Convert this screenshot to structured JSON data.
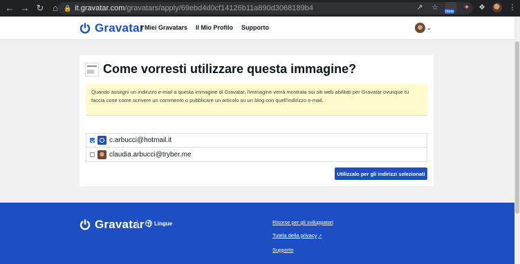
{
  "browser": {
    "url_host": "it.gravatar.com",
    "url_path": "/gravatars/apply/69ebd4d0cf14126b11a890d3068189b4",
    "extension_badge": "New"
  },
  "header": {
    "logo_text": "Gravatar",
    "nav": [
      "I Miei Gravatars",
      "Il Mio Profilo",
      "Supporto"
    ]
  },
  "card": {
    "title": "Come vorresti utilizzare questa immagine?",
    "notice": "Quando assegni un indirizzo e-mail a questa immagine di Gravatar, l'immagine verrà mostrata sui siti web abilitati per Gravatar ovunque tu faccia cose come scrivere un commento o pubblicare un articolo su un blog con quell'indirizzo e-mail.",
    "emails": [
      {
        "address": "c.arbucci@hotmail.it",
        "checked": true,
        "icon": "gravatar-logo-icon"
      },
      {
        "address": "claudia.arbucci@tryber.me",
        "checked": false,
        "icon": "avatar-photo-icon"
      }
    ],
    "apply_button": "Utilizzalo per gli indirizzi selezionati"
  },
  "footer": {
    "logo_text": "Gravatar",
    "language_label": "Lingue",
    "links": [
      "Risorse per gli sviluppatori",
      "Tutela della privacy",
      "Supporto"
    ]
  },
  "colors": {
    "brand_blue": "#1d4fc4",
    "notice_yellow": "#fffbcc"
  }
}
